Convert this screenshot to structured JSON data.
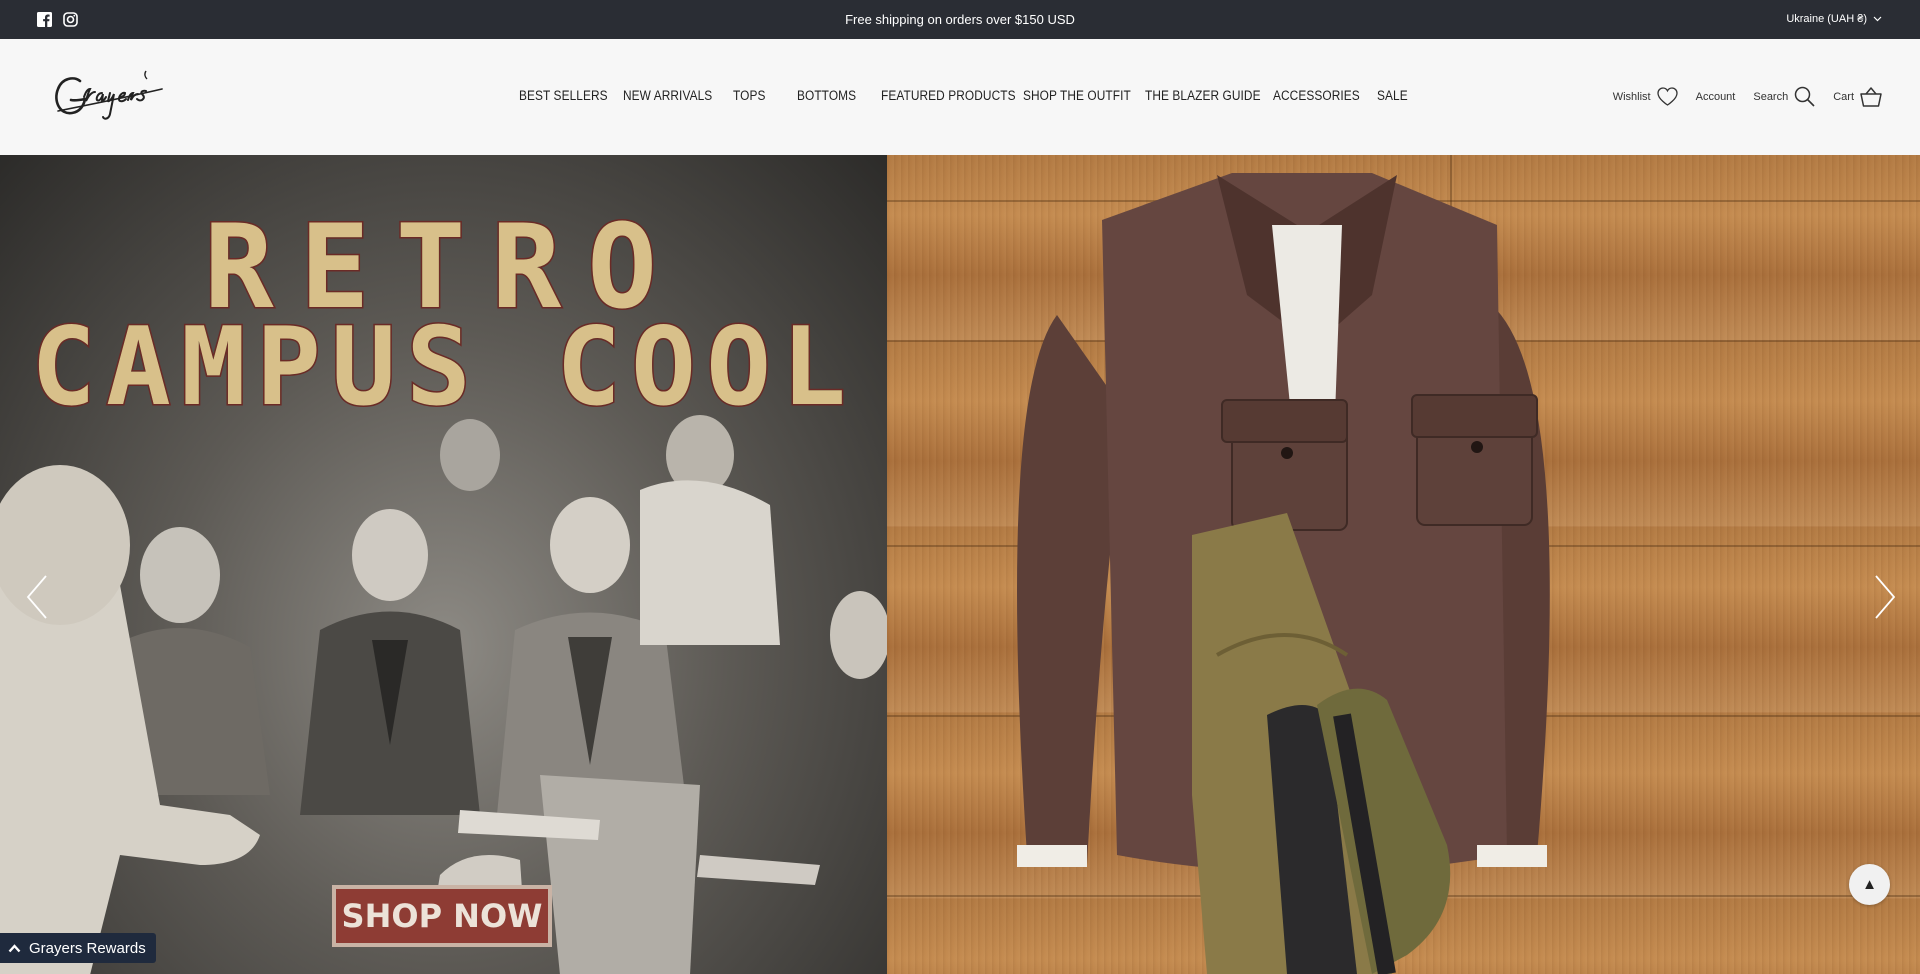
{
  "announcement": {
    "message": "Free shipping on orders over $150 USD",
    "region": "Ukraine (UAH ₴)",
    "social": [
      "facebook-icon",
      "instagram-icon"
    ]
  },
  "header": {
    "logo_text": "Grayers",
    "nav": [
      "BEST SELLERS",
      "NEW ARRIVALS",
      "TOPS",
      "BOTTOMS",
      "FEATURED PRODUCTS",
      "SHOP THE OUTFIT",
      "THE BLAZER GUIDE",
      "ACCESSORIES",
      "SALE"
    ],
    "utilities": {
      "wishlist": "Wishlist",
      "account": "Account",
      "search": "Search",
      "cart": "Cart"
    }
  },
  "hero": {
    "headline_line1": "RETRO",
    "headline_line2": "CAMPUS COOL",
    "cta": "SHOP NOW",
    "left_image": "vintage-classroom-photo",
    "right_image": "brown-shirt-jacket-khaki-pants-boots-flatlay"
  },
  "widgets": {
    "rewards_label": "Grayers Rewards",
    "scroll_top_icon": "▲"
  },
  "colors": {
    "announcement_bg": "#2a2d34",
    "header_bg": "#f7f7f7",
    "rewards_bg": "#1f2a3d",
    "cta_bg": "#8e3c34"
  }
}
